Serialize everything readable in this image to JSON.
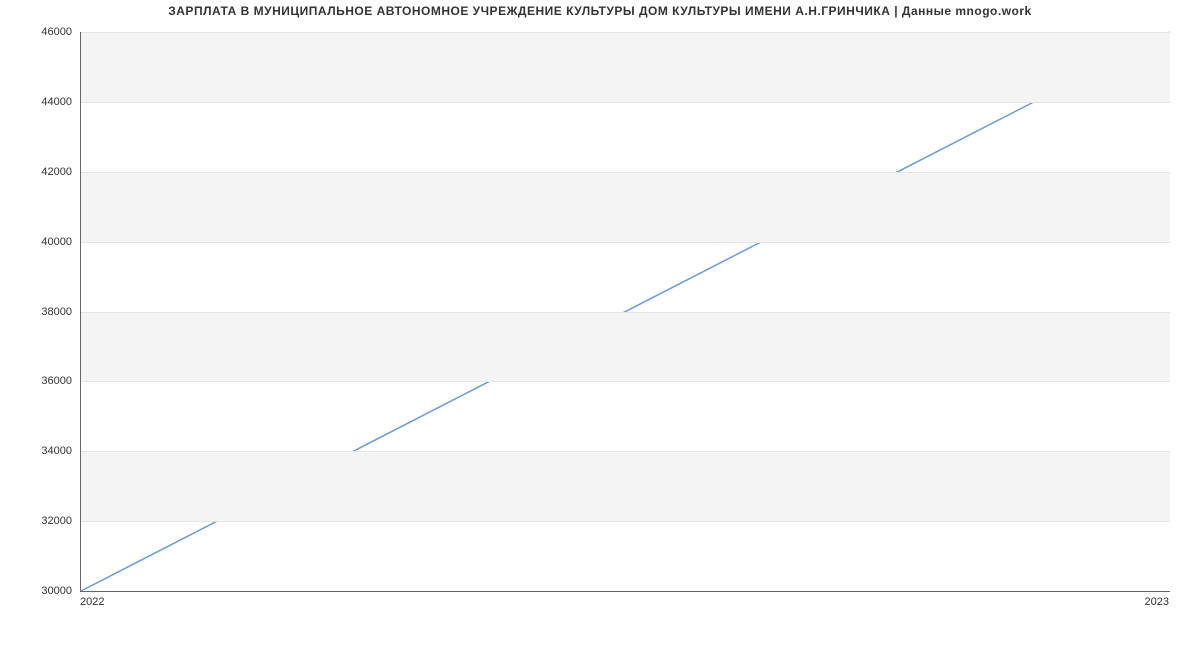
{
  "chart_data": {
    "type": "line",
    "title": "ЗАРПЛАТА В МУНИЦИПАЛЬНОЕ АВТОНОМНОЕ УЧРЕЖДЕНИЕ КУЛЬТУРЫ  ДОМ КУЛЬТУРЫ ИМЕНИ А.Н.ГРИНЧИКА | Данные mnogo.work",
    "x": [
      2022,
      2023
    ],
    "values": [
      30000,
      46000
    ],
    "xlabel": "",
    "ylabel": "",
    "xlim": [
      2022,
      2023
    ],
    "ylim": [
      30000,
      46000
    ],
    "x_ticks": [
      2022,
      2023
    ],
    "y_ticks": [
      30000,
      32000,
      34000,
      36000,
      38000,
      40000,
      42000,
      44000,
      46000
    ],
    "grid": true,
    "line_color": "#6b9bd2",
    "band_color": "#f4f4f4"
  }
}
